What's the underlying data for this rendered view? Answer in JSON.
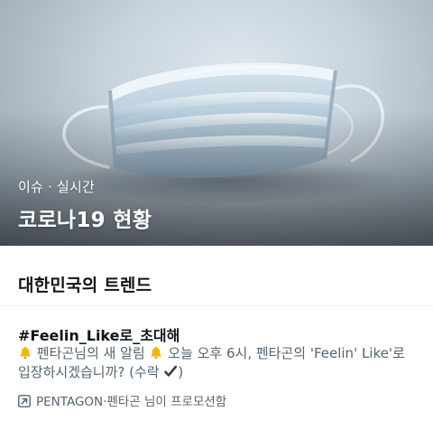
{
  "hero": {
    "category": "이슈",
    "separator": "·",
    "timeframe": "실시간",
    "title": "코로나19 현황",
    "image_subject": "surgical-face-mask-photo"
  },
  "section": {
    "title": "대한민국의 트렌드"
  },
  "trend": {
    "name": "#Feelin_Like로_초대해",
    "description": {
      "part1": " 펜타곤님의 새 알림 ",
      "part2": " 오늘 오후 6시, 펜타곤의 'Feelin' Like'로 입장하시겠습니까? (수락 ",
      "part3": ")"
    },
    "promoted_by": "PENTAGON·펜타곤 님이 프로모션함",
    "icons": {
      "bell": "bell-emoji-icon",
      "check": "check-mark-emoji-icon",
      "promoted": "promoted-arrow-icon"
    }
  },
  "colors": {
    "primary_text": "#0f1419",
    "secondary_text": "#536471",
    "divider": "#eff3f4",
    "bell": "#f5b700"
  }
}
